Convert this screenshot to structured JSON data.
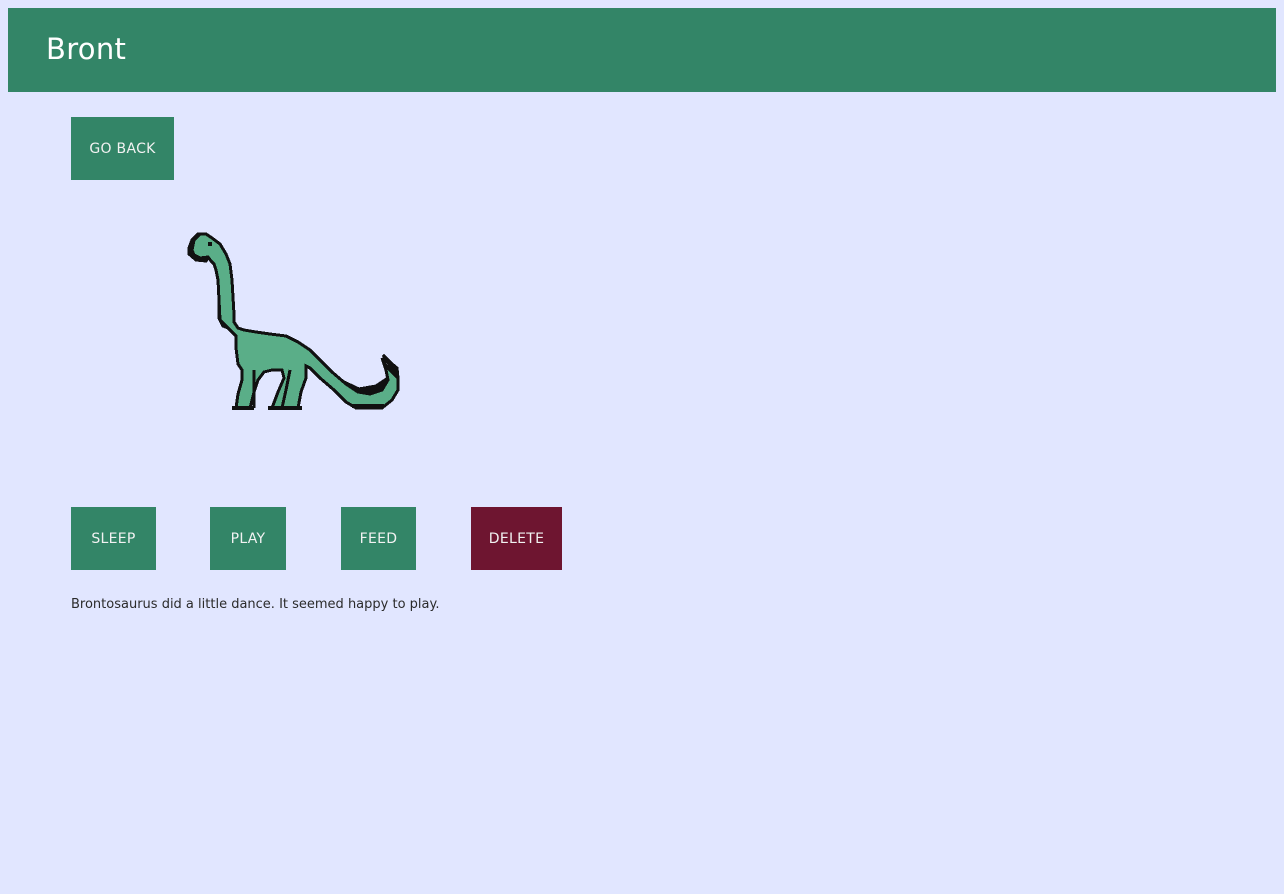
{
  "header": {
    "title": "Bront"
  },
  "nav": {
    "back_label": "GO BACK"
  },
  "pet": {
    "image_icon": "brontosaurus-pixel-art",
    "body_color": "#5aae88",
    "outline_color": "#111111"
  },
  "actions": {
    "sleep_label": "SLEEP",
    "play_label": "PLAY",
    "feed_label": "FEED",
    "delete_label": "DELETE"
  },
  "status": {
    "message": "Brontosaurus did a little dance. It seemed happy to play."
  },
  "colors": {
    "background": "#e1e6ff",
    "primary": "#338567",
    "danger": "#6e1530"
  }
}
